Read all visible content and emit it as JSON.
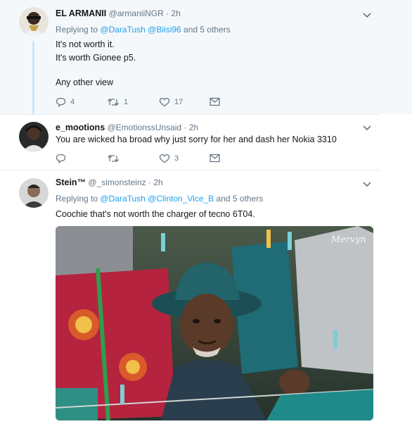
{
  "tweets": [
    {
      "name": "EL ARMANII",
      "handle": "@armaniiNGR",
      "dot": "·",
      "time": "2h",
      "replying_prefix": "Replying to",
      "mentions": [
        "@DaraTush",
        "@Biisi96"
      ],
      "and_others": "and 5 others",
      "lines": [
        "It's not worth it.",
        "It's worth Gionee p5.",
        "Any other view"
      ],
      "reply_count": "4",
      "retweet_count": "1",
      "like_count": "17"
    },
    {
      "name": "e_mootions",
      "handle": "@EmotionssUnsaid",
      "dot": "·",
      "time": "2h",
      "lines": [
        "You are wicked ha broad why just sorry for her and dash her Nokia 3310"
      ],
      "reply_count": "",
      "retweet_count": "",
      "like_count": "3"
    },
    {
      "name": "Stein™",
      "handle": "@_simonsteinz",
      "dot": "·",
      "time": "2h",
      "replying_prefix": "Replying to",
      "mentions": [
        "@DaraTush",
        "@Clinton_Vice_B"
      ],
      "and_others": "and 5 others",
      "lines": [
        "Coochie that's not worth the charger of tecno 6T04."
      ],
      "watermark": "Mervyn"
    }
  ],
  "icons": {
    "reply": "reply-icon",
    "retweet": "retweet-icon",
    "like": "heart-icon",
    "dm": "envelope-icon",
    "more": "chevron-down-icon"
  },
  "colors": {
    "link": "#1da1f2",
    "muted": "#657786",
    "thread_line": "#cfe6f7",
    "highlight_bg": "#f5f8fa"
  }
}
